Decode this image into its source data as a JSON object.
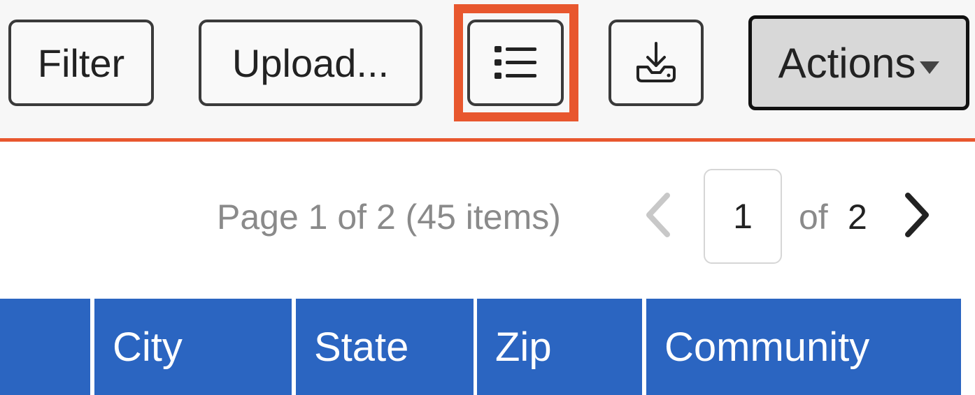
{
  "toolbar": {
    "filter_label": "Filter",
    "upload_label": "Upload...",
    "list_icon": "list-icon",
    "download_icon": "download-tray-icon",
    "actions_label": "Actions",
    "accent_color": "#e8572e"
  },
  "pagination": {
    "summary": "Page 1 of 2 (45 items)",
    "current_page": "1",
    "of_label": "of",
    "total_pages": "2"
  },
  "table": {
    "header_color": "#2b65c1",
    "columns": [
      "",
      "City",
      "State",
      "Zip",
      "Community"
    ]
  }
}
